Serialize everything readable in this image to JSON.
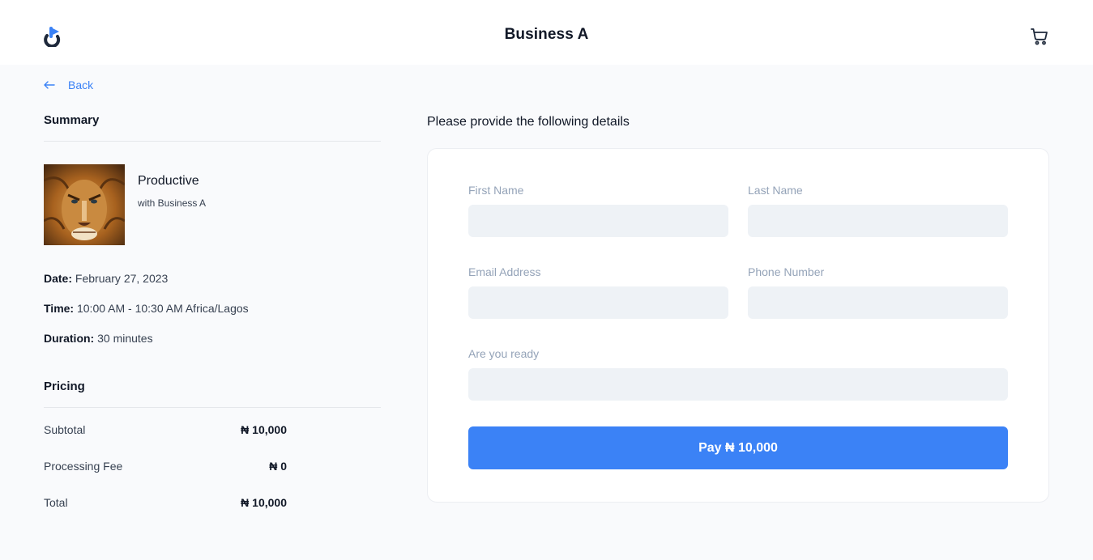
{
  "header": {
    "title": "Business A",
    "logo_icon": "brand-logo-icon",
    "cart_icon": "cart-icon"
  },
  "nav": {
    "back_label": "Back"
  },
  "summary": {
    "title": "Summary",
    "service_name": "Productive",
    "service_provider": "with Business A",
    "date_label": "Date:",
    "date_value": "February 27, 2023",
    "time_label": "Time:",
    "time_value": "10:00 AM - 10:30 AM Africa/Lagos",
    "duration_label": "Duration:",
    "duration_value": "30 minutes"
  },
  "pricing": {
    "title": "Pricing",
    "rows": [
      {
        "label": "Subtotal",
        "amount": "₦ 10,000"
      },
      {
        "label": "Processing Fee",
        "amount": "₦ 0"
      },
      {
        "label": "Total",
        "amount": "₦ 10,000"
      }
    ]
  },
  "form": {
    "heading": "Please provide the following details",
    "first_name_label": "First Name",
    "first_name_value": "",
    "last_name_label": "Last Name",
    "last_name_value": "",
    "email_label": "Email Address",
    "email_value": "",
    "phone_label": "Phone Number",
    "phone_value": "",
    "ready_label": "Are you ready",
    "ready_value": "",
    "pay_button": "Pay ₦ 10,000"
  },
  "colors": {
    "accent": "#3b82f6",
    "background": "#f9fafc",
    "field_bg": "#eef2f6"
  }
}
